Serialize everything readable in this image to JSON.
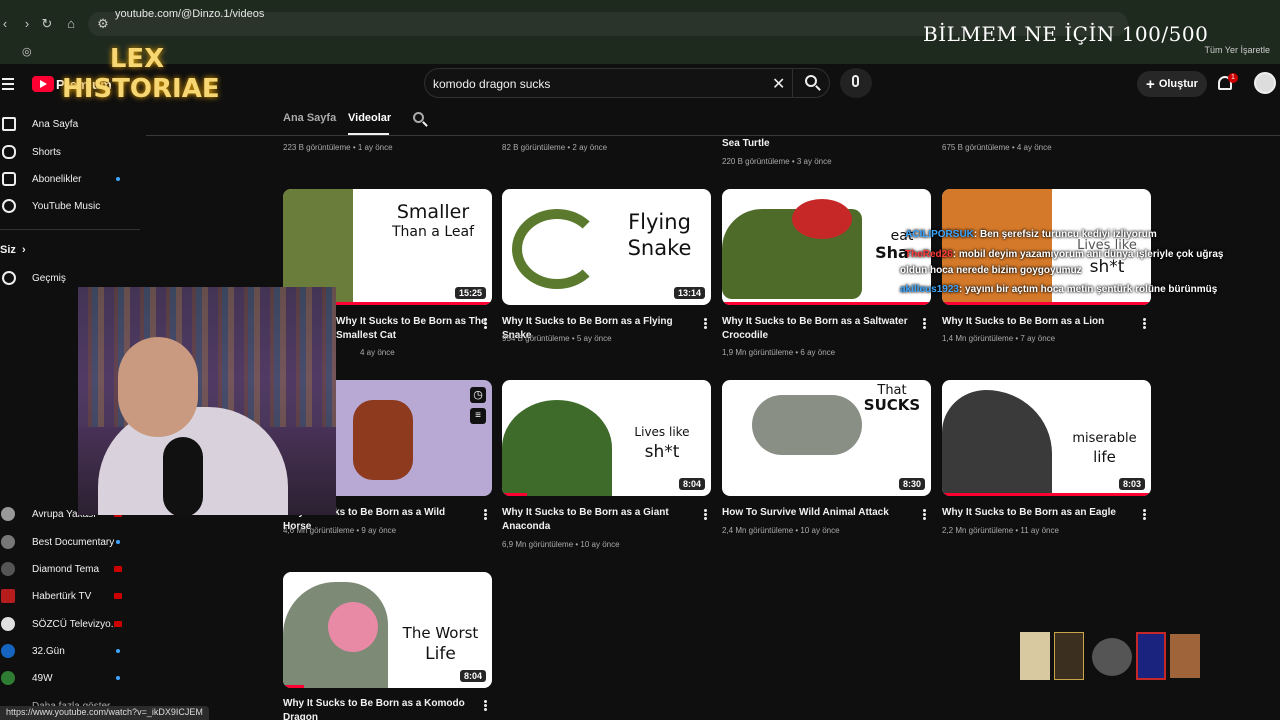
{
  "browser": {
    "url": "youtube.com/@Dinzo.1/videos",
    "bookmarks_label": "Tüm Yer İşaretle",
    "status_url": "https://www.youtube.com/watch?v=_ikDX9ICJEM"
  },
  "stream_overlay": {
    "title": "BİLMEM NE İÇİN 100/500",
    "logo_line1": "LEX",
    "logo_line2": "HISTORIAE"
  },
  "header": {
    "brand": "Premium",
    "search_value": "komodo dragon sucks",
    "create_label": "Oluştur",
    "notification_count": "1"
  },
  "sidebar": {
    "items": [
      {
        "label": "Ana Sayfa"
      },
      {
        "label": "Shorts"
      },
      {
        "label": "Abonelikler"
      },
      {
        "label": "YouTube Music"
      }
    ],
    "you_label": "Siz",
    "history_label": "Geçmiş",
    "subscriptions": [
      {
        "label": "Avrupa Yakası"
      },
      {
        "label": "Best Documentary"
      },
      {
        "label": "Diamond Tema"
      },
      {
        "label": "Habertürk TV"
      },
      {
        "label": "SÖZCÜ Televizyo..."
      },
      {
        "label": "32.Gün"
      },
      {
        "label": "49W"
      }
    ],
    "show_more": "Daha fazla göster"
  },
  "tabs": {
    "home": "Ana Sayfa",
    "videos": "Videolar"
  },
  "top_row_meta": [
    {
      "meta": "223 B görüntüleme • 1 ay önce"
    },
    {
      "meta": "82 B görüntüleme • 2 ay önce"
    },
    {
      "title": "Sea Turtle",
      "meta": "220 B görüntüleme • 3 ay önce"
    },
    {
      "meta": "675 B görüntüleme • 4 ay önce"
    }
  ],
  "videos": [
    {
      "title": "Why It Sucks to Be Born as The Smallest Cat",
      "meta": "4 ay önce",
      "duration": "15:25",
      "caption_1": "Smaller",
      "caption_2": "Than a Leaf"
    },
    {
      "title": "Why It Sucks to Be Born as a Flying Snake",
      "meta": "954 B görüntüleme • 5 ay önce",
      "duration": "13:14",
      "caption_1": "Flying",
      "caption_2": "Snake"
    },
    {
      "title": "Why It Sucks to Be Born as a Saltwater Crocodile",
      "meta": "1,9 Mn görüntüleme • 6 ay önce",
      "duration": "",
      "caption_1": "eat",
      "caption_2": "Sha"
    },
    {
      "title": "Why It Sucks to Be Born as a Lion",
      "meta": "1,4 Mn görüntüleme • 7 ay önce",
      "duration": "",
      "caption_1": "Lives like",
      "caption_2": "sh*t"
    },
    {
      "title": "Why It Sucks to Be Born as a Wild Horse",
      "meta": "4,6 Mn görüntüleme • 9 ay önce",
      "duration": "",
      "caption_1": "",
      "caption_2": ""
    },
    {
      "title": "Why It Sucks to Be Born as a Giant Anaconda",
      "meta": "6,9 Mn görüntüleme • 10 ay önce",
      "duration": "8:04",
      "caption_1": "Lives like",
      "caption_2": "sh*t"
    },
    {
      "title": "How To Survive Wild Animal Attack",
      "meta": "2,4 Mn görüntüleme • 10 ay önce",
      "duration": "8:30",
      "caption_1": "That",
      "caption_2": "SUCKS"
    },
    {
      "title": "Why It Sucks to Be Born as an Eagle",
      "meta": "2,2 Mn görüntüleme • 11 ay önce",
      "duration": "8:03",
      "caption_1": "miserable",
      "caption_2": "life"
    },
    {
      "title": "Why It Sucks to Be Born as a Komodo Dragon",
      "meta": "",
      "duration": "8:04",
      "caption_1": "The Worst",
      "caption_2": "Life"
    }
  ],
  "chat": [
    {
      "user": "ACILIPORSUK",
      "text": ": Ben şerefsiz turuncu kediyi izliyorum"
    },
    {
      "user": "TheRed26",
      "text": ": mobil deyim yazamıyorum ani dünya işleriyle çok uğraş"
    },
    {
      "user": "",
      "text": "oldun hoca nerede bizim goygoyumuz"
    },
    {
      "user": "akilleus1923",
      "text": ": yayını bir açtım hoca metin şentürk rolüne bürünmüş"
    }
  ],
  "colors": {
    "accent": "#ff0033",
    "background": "#0f0f0f",
    "link": "#3ea6ff"
  }
}
